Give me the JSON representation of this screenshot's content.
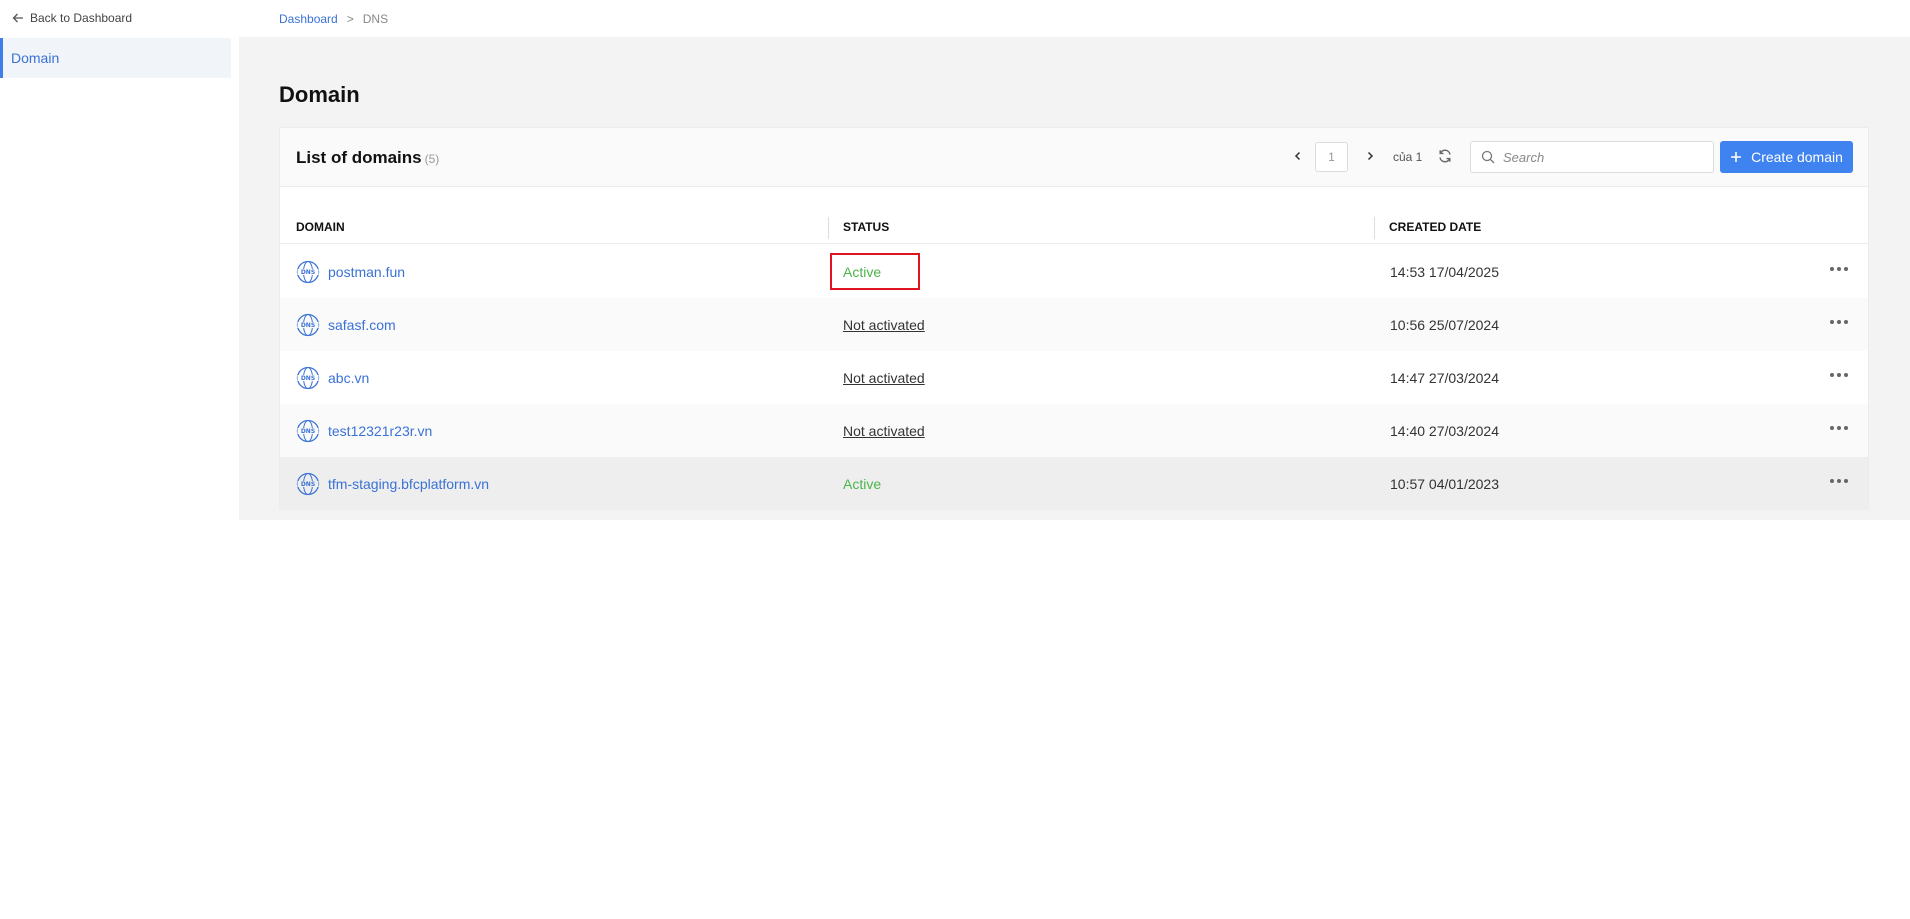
{
  "sidebar": {
    "back_label": "Back to Dashboard",
    "items": [
      {
        "label": "Domain"
      }
    ]
  },
  "breadcrumb": {
    "items": [
      "Dashboard",
      "DNS"
    ],
    "separator": ">"
  },
  "page": {
    "title": "Domain"
  },
  "card": {
    "title": "List of domains",
    "count": "(5)",
    "pager": {
      "page": "1",
      "of_label": "của 1"
    },
    "search": {
      "placeholder": "Search"
    },
    "create_label": "Create domain"
  },
  "table": {
    "headers": [
      "DOMAIN",
      "STATUS",
      "CREATED DATE"
    ],
    "rows": [
      {
        "domain": "postman.fun",
        "status": "Active",
        "created": "14:53 17/04/2025"
      },
      {
        "domain": "safasf.com",
        "status": "Not activated",
        "created": "10:56 25/07/2024"
      },
      {
        "domain": "abc.vn",
        "status": "Not activated",
        "created": "14:47 27/03/2024"
      },
      {
        "domain": "test12321r23r.vn",
        "status": "Not activated",
        "created": "14:40 27/03/2024"
      },
      {
        "domain": "tfm-staging.bfcplatform.vn",
        "status": "Active",
        "created": "10:57 04/01/2023"
      }
    ]
  },
  "colors": {
    "accent": "#3f83f0",
    "link": "#3a72d6",
    "active": "#4cb54c",
    "highlight": "#e0141e"
  },
  "icons": {
    "back": "arrow-left-icon",
    "prev": "chevron-left-icon",
    "next": "chevron-right-icon",
    "refresh": "refresh-icon",
    "search": "search-icon",
    "create": "plus-icon",
    "domain": "dns-globe-icon",
    "row_menu": "more-horizontal-icon"
  }
}
